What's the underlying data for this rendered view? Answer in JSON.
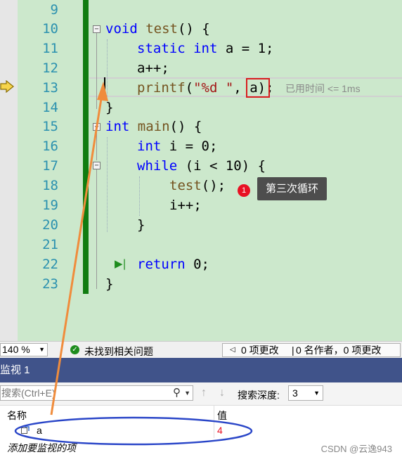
{
  "editor": {
    "line_numbers": [
      "9",
      "10",
      "11",
      "12",
      "13",
      "14",
      "15",
      "16",
      "17",
      "18",
      "19",
      "20",
      "21",
      "22",
      "23"
    ],
    "lines": {
      "l10_kw": "void",
      "l10_fn": "test",
      "l10_rest": "() {",
      "l11_kw1": "static",
      "l11_kw2": "int",
      "l11_rest": " a = 1;",
      "l12": "a++;",
      "l13_fn": "printf",
      "l13_open": "(",
      "l13_str": "\"%d \"",
      "l13_mid": ", ",
      "l13_arg": "a",
      "l13_end": ");",
      "l14": "}",
      "l15_kw": "int",
      "l15_fn": "main",
      "l15_rest": "() {",
      "l16_kw": "int",
      "l16_rest": " i = 0;",
      "l17_kw": "while",
      "l17_rest": " (i < 10) {",
      "l18_fn": "test",
      "l18_rest": "();",
      "l19": "i++;",
      "l20": "}",
      "l22_kw": "return",
      "l22_rest": " 0;",
      "l23": "}"
    },
    "elapsed_hint": "已用时间 <= 1ms",
    "breakpoint_number": "1",
    "breakpoint_label": "第三次循环",
    "fold_minus": "−"
  },
  "status_bar": {
    "zoom": "140 %",
    "issues_text": "未找到相关问题",
    "changes_text": "0 项更改",
    "authors_text": "0 名作者，0 项更改"
  },
  "watch": {
    "title": "监视 1",
    "search_placeholder": "搜索(Ctrl+E)",
    "depth_label": "搜索深度:",
    "depth_value": "3",
    "col_name": "名称",
    "col_value": "值",
    "rows": [
      {
        "name": "a",
        "value": "4"
      }
    ],
    "add_item_text": "添加要监视的项",
    "credit": "CSDN @云逸943"
  },
  "colors": {
    "editor_bg": "#cce8cc",
    "keyword": "#0000ff",
    "function": "#74531f",
    "string": "#a31515",
    "line_number": "#2b91af",
    "highlight_red": "#d81e1e",
    "annotation_orange": "#f08c3c",
    "annotation_blue": "#2a46c8",
    "watch_header": "#40538a"
  }
}
